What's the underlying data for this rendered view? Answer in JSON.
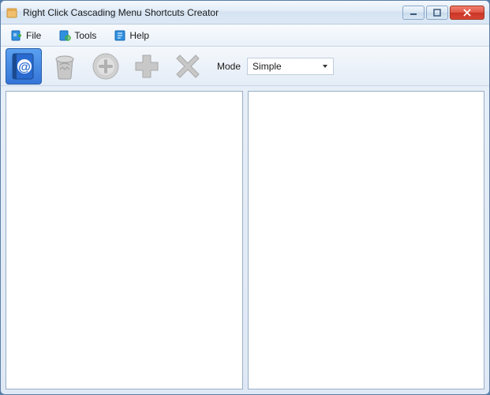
{
  "window": {
    "title": "Right Click Cascading Menu Shortcuts Creator"
  },
  "menubar": {
    "file": "File",
    "tools": "Tools",
    "help": "Help"
  },
  "toolbar": {
    "mode_label": "Mode",
    "mode_value": "Simple"
  }
}
